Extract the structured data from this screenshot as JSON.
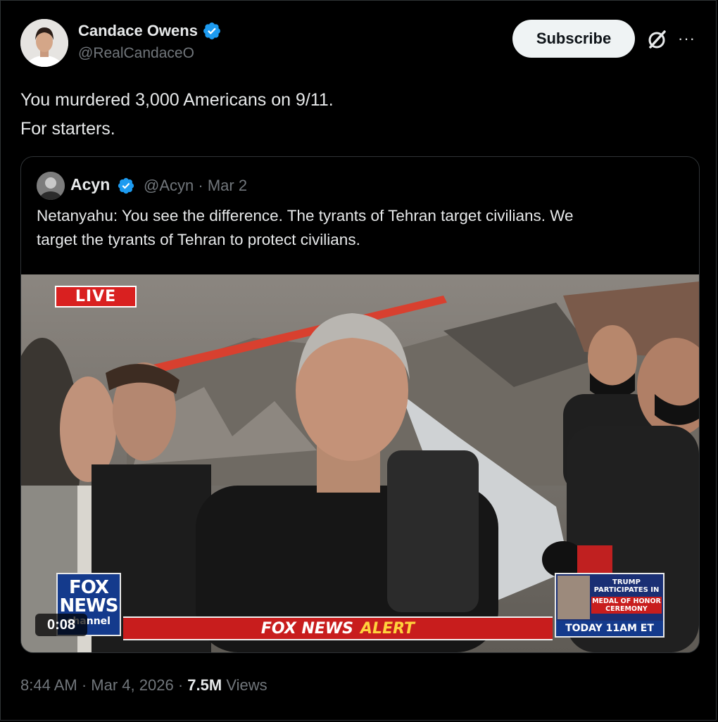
{
  "author": {
    "name": "Candace Owens",
    "handle": "@RealCandaceO",
    "verified_icon": "verified-badge-icon"
  },
  "actions": {
    "subscribe_label": "Subscribe",
    "grok_icon": "grok-slash-icon",
    "more_icon": "more-icon",
    "more_glyph": "···"
  },
  "tweet": {
    "lines": [
      "You murdered 3,000 Americans on 9/11.",
      "For starters."
    ]
  },
  "quote": {
    "name": "Acyn",
    "handle": "@Acyn",
    "separator": "·",
    "date": "Mar 2",
    "text_lines": [
      "Netanyahu: You see the difference. The tyrants of Tehran target civilians. We",
      "target the tyrants of Tehran to protect civilians."
    ],
    "video": {
      "live_badge": "LIVE",
      "logo_line1": "FOX",
      "logo_line2": "NEWS",
      "logo_line3": "channel",
      "alert_part1": "FOX NEWS",
      "alert_part2": "ALERT",
      "promo_line1": "TRUMP PARTICIPATES IN",
      "promo_line2": "MEDAL OF HONOR CEREMONY",
      "promo_line3": "TODAY 11AM ET",
      "timer": "0:08"
    }
  },
  "footer": {
    "time": "8:44 AM",
    "date": "Mar 4, 2026",
    "separator": "·",
    "views_count": "7.5M",
    "views_label": "Views"
  },
  "colors": {
    "background": "#000000",
    "verified_blue": "#1d9bf0",
    "muted_text": "#71767b",
    "border": "#2f3336",
    "alert_red": "#c81d1d",
    "fox_blue": "#143a8c"
  }
}
